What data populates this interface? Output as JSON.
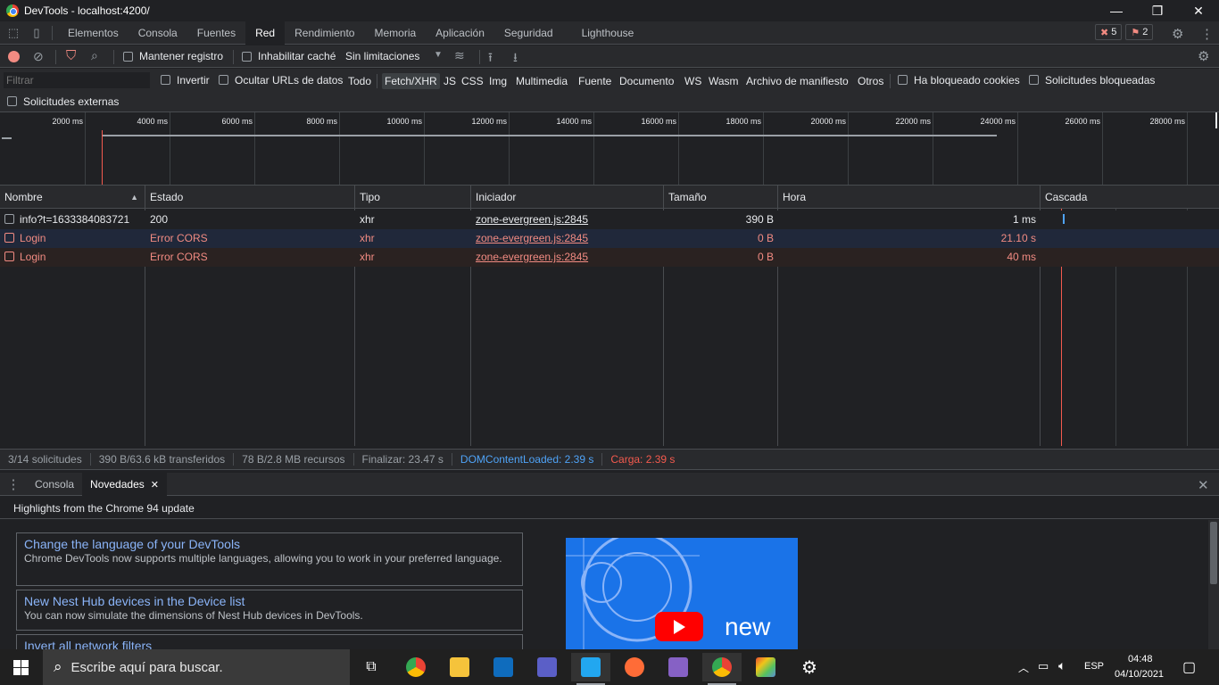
{
  "window": {
    "title": "DevTools - localhost:4200/"
  },
  "tabs": [
    "Elementos",
    "Consola",
    "Fuentes",
    "Red",
    "Rendimiento",
    "Memoria",
    "Aplicación",
    "Seguridad",
    "Lighthouse"
  ],
  "active_tab": "Red",
  "badges": {
    "errors": "5",
    "issues": "2"
  },
  "toolbar": {
    "preserve_log": "Mantener registro",
    "disable_cache": "Inhabilitar caché",
    "throttling": "Sin limitaciones"
  },
  "filter": {
    "placeholder": "Filtrar",
    "invert": "Invertir",
    "hide_data_urls": "Ocultar URLs de datos",
    "types": [
      "Todo",
      "Fetch/XHR",
      "JS",
      "CSS",
      "Img",
      "Multimedia",
      "Fuente",
      "Documento",
      "WS",
      "Wasm",
      "Archivo de manifiesto",
      "Otros"
    ],
    "active_type": "Fetch/XHR",
    "blocked_cookies": "Ha bloqueado cookies",
    "blocked_requests": "Solicitudes bloqueadas",
    "third_party": "Solicitudes externas"
  },
  "overview": {
    "ticks": [
      "2000 ms",
      "4000 ms",
      "6000 ms",
      "8000 ms",
      "10000 ms",
      "12000 ms",
      "14000 ms",
      "16000 ms",
      "18000 ms",
      "20000 ms",
      "22000 ms",
      "24000 ms",
      "26000 ms",
      "28000 ms"
    ]
  },
  "columns": {
    "name": "Nombre",
    "status": "Estado",
    "type": "Tipo",
    "initiator": "Iniciador",
    "size": "Tamaño",
    "time": "Hora",
    "waterfall": "Cascada"
  },
  "rows": [
    {
      "name": "info?t=1633384083721",
      "status": "200",
      "type": "xhr",
      "initiator": "zone-evergreen.js:2845",
      "size": "390 B",
      "time": "1 ms",
      "error": false
    },
    {
      "name": "Login",
      "status": "Error CORS",
      "type": "xhr",
      "initiator": "zone-evergreen.js:2845",
      "size": "0 B",
      "time": "21.10 s",
      "error": true
    },
    {
      "name": "Login",
      "status": "Error CORS",
      "type": "xhr",
      "initiator": "zone-evergreen.js:2845",
      "size": "0 B",
      "time": "40 ms",
      "error": true
    }
  ],
  "summary": {
    "requests": "3/14 solicitudes",
    "transferred": "390 B/63.6 kB transferidos",
    "resources": "78 B/2.8 MB recursos",
    "finish": "Finalizar: 23.47 s",
    "dcl": "DOMContentLoaded: 2.39 s",
    "load": "Carga: 2.39 s"
  },
  "drawer": {
    "tabs": [
      "Consola",
      "Novedades"
    ],
    "active": "Novedades",
    "headline": "Highlights from the Chrome 94 update",
    "cards": [
      {
        "title": "Change the language of your DevTools",
        "desc": "Chrome DevTools now supports multiple languages, allowing you to work in your preferred language."
      },
      {
        "title": "New Nest Hub devices in the Device list",
        "desc": "You can now simulate the dimensions of Nest Hub devices in DevTools."
      },
      {
        "title": "Invert all network filters",
        "desc": ""
      }
    ],
    "video_text": "new"
  },
  "taskbar": {
    "search_placeholder": "Escribe aquí para buscar.",
    "lang": "ESP",
    "time": "04:48",
    "date": "04/10/2021"
  },
  "colors": {
    "error": "#f28b82",
    "link_blue": "#8ab4f8",
    "dcl": "#4fa3f7",
    "load": "#f45a4e",
    "accent": "#1a73e8"
  }
}
